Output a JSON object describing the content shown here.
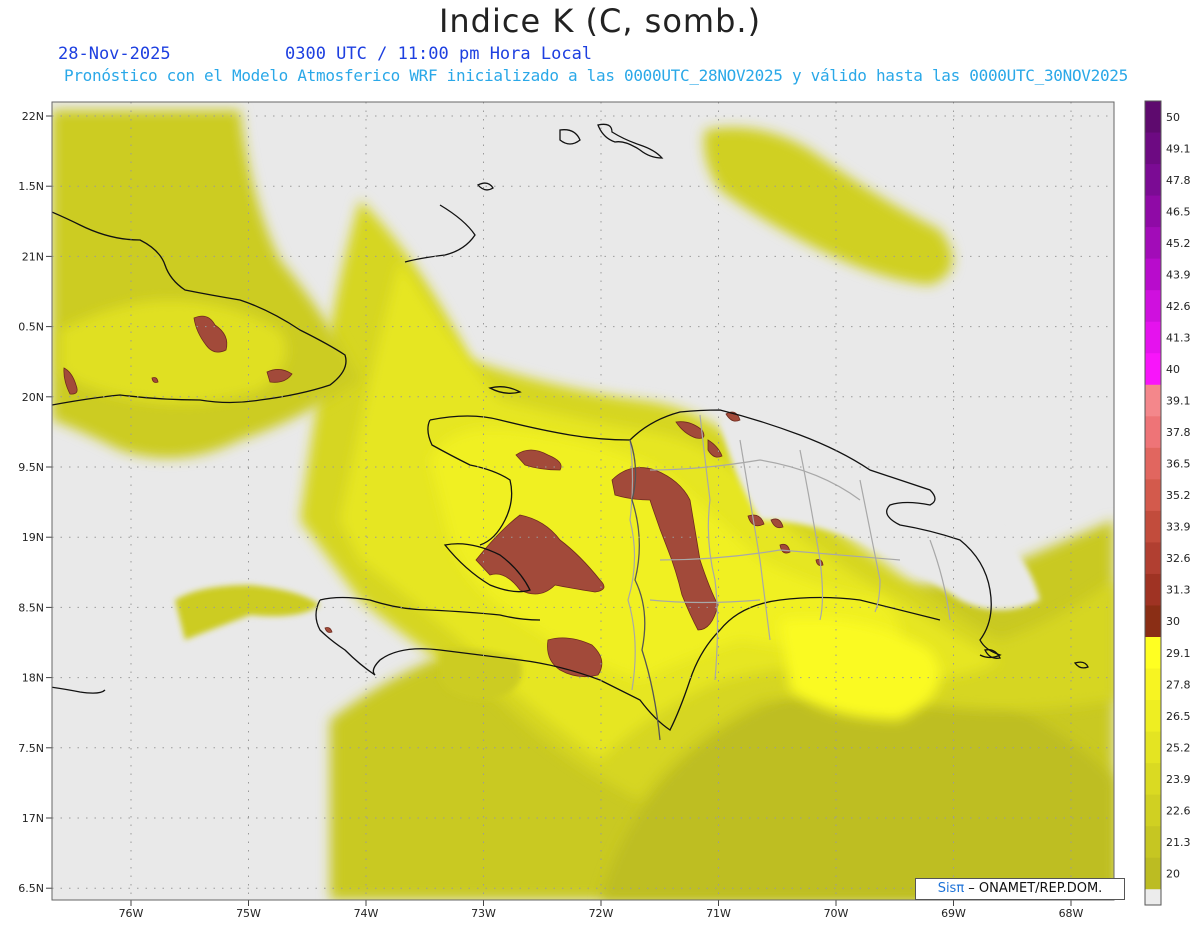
{
  "title": "Indice K (C, somb.)",
  "date": "28-Nov-2025",
  "time_line": "0300 UTC / 11:00 pm Hora Local",
  "forecast_line": "Pronóstico con el Modelo Atmosferico WRF inicializado a las 0000UTC_28NOV2025 y válido hasta las  0000UTC_30NOV2025",
  "credit": {
    "sis": "Sisπ",
    "rest": " – ONAMET/REP.DOM."
  },
  "map": {
    "lat_labels": [
      "22N",
      "1.5N",
      "21N",
      "0.5N",
      "20N",
      "9.5N",
      "19N",
      "8.5N",
      "18N",
      "7.5N",
      "17N",
      "6.5N"
    ],
    "lon_labels": [
      "76W",
      "75W",
      "74W",
      "73W",
      "72W",
      "71W",
      "70W",
      "69W",
      "68W"
    ]
  },
  "legend": {
    "values": [
      "50",
      "49.1",
      "47.8",
      "46.5",
      "45.2",
      "43.9",
      "42.6",
      "41.3",
      "40",
      "39.1",
      "37.8",
      "36.5",
      "35.2",
      "33.9",
      "32.6",
      "31.3",
      "30",
      "29.1",
      "27.8",
      "26.5",
      "25.2",
      "23.9",
      "22.6",
      "21.3",
      "20"
    ],
    "colors": [
      "#5e0a6e",
      "#6d0a82",
      "#7b0b94",
      "#8f0aa6",
      "#a20cb8",
      "#b80ccc",
      "#cf10de",
      "#e512ee",
      "#f815fa",
      "#f4878b",
      "#ee7477",
      "#e1665f",
      "#d35a4c",
      "#c24c3c",
      "#b13f31",
      "#9f3323",
      "#8a2e15",
      "#ffff22",
      "#f7f422",
      "#eeee22",
      "#e4e422",
      "#dada22",
      "#d0d022",
      "#c6c622",
      "#bcbc22"
    ],
    "bottom_color": "#ececec"
  }
}
